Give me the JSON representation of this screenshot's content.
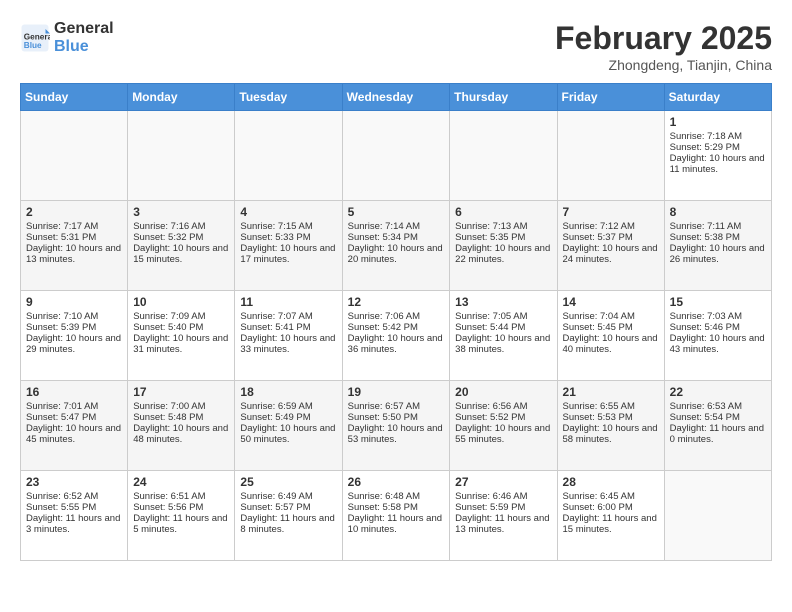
{
  "header": {
    "logo_line1": "General",
    "logo_line2": "Blue",
    "month": "February 2025",
    "location": "Zhongdeng, Tianjin, China"
  },
  "days_of_week": [
    "Sunday",
    "Monday",
    "Tuesday",
    "Wednesday",
    "Thursday",
    "Friday",
    "Saturday"
  ],
  "weeks": [
    [
      {
        "day": "",
        "info": ""
      },
      {
        "day": "",
        "info": ""
      },
      {
        "day": "",
        "info": ""
      },
      {
        "day": "",
        "info": ""
      },
      {
        "day": "",
        "info": ""
      },
      {
        "day": "",
        "info": ""
      },
      {
        "day": "1",
        "info": "Sunrise: 7:18 AM\nSunset: 5:29 PM\nDaylight: 10 hours and 11 minutes."
      }
    ],
    [
      {
        "day": "2",
        "info": "Sunrise: 7:17 AM\nSunset: 5:31 PM\nDaylight: 10 hours and 13 minutes."
      },
      {
        "day": "3",
        "info": "Sunrise: 7:16 AM\nSunset: 5:32 PM\nDaylight: 10 hours and 15 minutes."
      },
      {
        "day": "4",
        "info": "Sunrise: 7:15 AM\nSunset: 5:33 PM\nDaylight: 10 hours and 17 minutes."
      },
      {
        "day": "5",
        "info": "Sunrise: 7:14 AM\nSunset: 5:34 PM\nDaylight: 10 hours and 20 minutes."
      },
      {
        "day": "6",
        "info": "Sunrise: 7:13 AM\nSunset: 5:35 PM\nDaylight: 10 hours and 22 minutes."
      },
      {
        "day": "7",
        "info": "Sunrise: 7:12 AM\nSunset: 5:37 PM\nDaylight: 10 hours and 24 minutes."
      },
      {
        "day": "8",
        "info": "Sunrise: 7:11 AM\nSunset: 5:38 PM\nDaylight: 10 hours and 26 minutes."
      }
    ],
    [
      {
        "day": "9",
        "info": "Sunrise: 7:10 AM\nSunset: 5:39 PM\nDaylight: 10 hours and 29 minutes."
      },
      {
        "day": "10",
        "info": "Sunrise: 7:09 AM\nSunset: 5:40 PM\nDaylight: 10 hours and 31 minutes."
      },
      {
        "day": "11",
        "info": "Sunrise: 7:07 AM\nSunset: 5:41 PM\nDaylight: 10 hours and 33 minutes."
      },
      {
        "day": "12",
        "info": "Sunrise: 7:06 AM\nSunset: 5:42 PM\nDaylight: 10 hours and 36 minutes."
      },
      {
        "day": "13",
        "info": "Sunrise: 7:05 AM\nSunset: 5:44 PM\nDaylight: 10 hours and 38 minutes."
      },
      {
        "day": "14",
        "info": "Sunrise: 7:04 AM\nSunset: 5:45 PM\nDaylight: 10 hours and 40 minutes."
      },
      {
        "day": "15",
        "info": "Sunrise: 7:03 AM\nSunset: 5:46 PM\nDaylight: 10 hours and 43 minutes."
      }
    ],
    [
      {
        "day": "16",
        "info": "Sunrise: 7:01 AM\nSunset: 5:47 PM\nDaylight: 10 hours and 45 minutes."
      },
      {
        "day": "17",
        "info": "Sunrise: 7:00 AM\nSunset: 5:48 PM\nDaylight: 10 hours and 48 minutes."
      },
      {
        "day": "18",
        "info": "Sunrise: 6:59 AM\nSunset: 5:49 PM\nDaylight: 10 hours and 50 minutes."
      },
      {
        "day": "19",
        "info": "Sunrise: 6:57 AM\nSunset: 5:50 PM\nDaylight: 10 hours and 53 minutes."
      },
      {
        "day": "20",
        "info": "Sunrise: 6:56 AM\nSunset: 5:52 PM\nDaylight: 10 hours and 55 minutes."
      },
      {
        "day": "21",
        "info": "Sunrise: 6:55 AM\nSunset: 5:53 PM\nDaylight: 10 hours and 58 minutes."
      },
      {
        "day": "22",
        "info": "Sunrise: 6:53 AM\nSunset: 5:54 PM\nDaylight: 11 hours and 0 minutes."
      }
    ],
    [
      {
        "day": "23",
        "info": "Sunrise: 6:52 AM\nSunset: 5:55 PM\nDaylight: 11 hours and 3 minutes."
      },
      {
        "day": "24",
        "info": "Sunrise: 6:51 AM\nSunset: 5:56 PM\nDaylight: 11 hours and 5 minutes."
      },
      {
        "day": "25",
        "info": "Sunrise: 6:49 AM\nSunset: 5:57 PM\nDaylight: 11 hours and 8 minutes."
      },
      {
        "day": "26",
        "info": "Sunrise: 6:48 AM\nSunset: 5:58 PM\nDaylight: 11 hours and 10 minutes."
      },
      {
        "day": "27",
        "info": "Sunrise: 6:46 AM\nSunset: 5:59 PM\nDaylight: 11 hours and 13 minutes."
      },
      {
        "day": "28",
        "info": "Sunrise: 6:45 AM\nSunset: 6:00 PM\nDaylight: 11 hours and 15 minutes."
      },
      {
        "day": "",
        "info": ""
      }
    ]
  ]
}
